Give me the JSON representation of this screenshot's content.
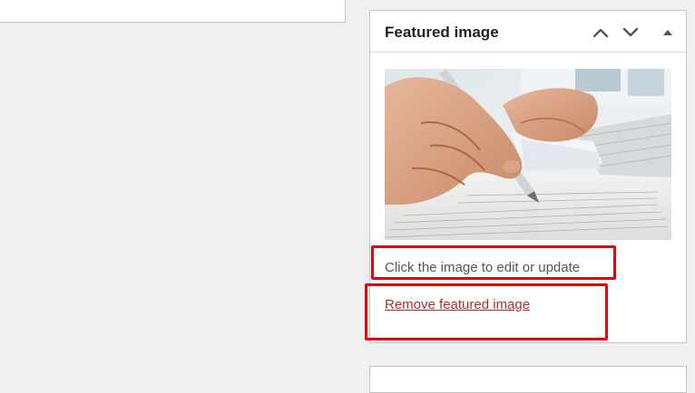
{
  "featured_image_box": {
    "title": "Featured image",
    "move_up_icon": "chevron-up-icon",
    "move_down_icon": "chevron-down-icon",
    "toggle_icon": "triangle-up-icon",
    "image_description": "featured-image-thumbnail",
    "help_text": "Click the image to edit or update",
    "remove_link": "Remove featured image"
  },
  "colors": {
    "background": "#f0f0f1",
    "panel": "#ffffff",
    "border": "#c3c4c7",
    "link_red": "#b32d2e",
    "highlight_red": "#e8000b"
  }
}
